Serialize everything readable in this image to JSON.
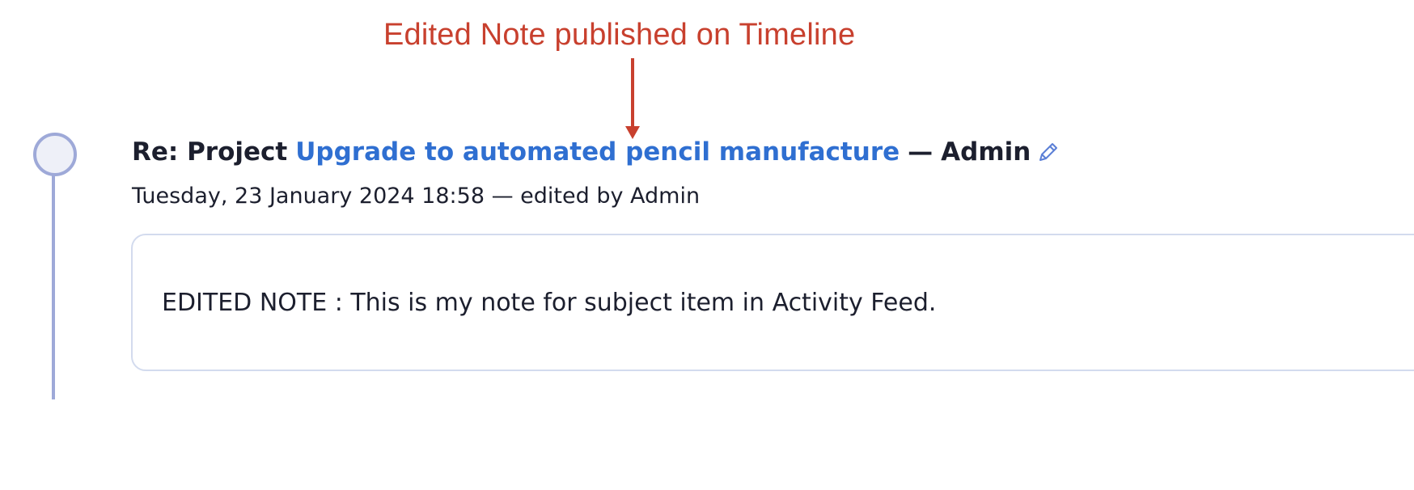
{
  "annotation": {
    "text": "Edited Note published on Timeline",
    "color": "#c8402e"
  },
  "timeline": {
    "line_color": "#9ea9d8"
  },
  "entry": {
    "prefix": "Re: Project",
    "project_link": "Upgrade to automated pencil manufacture",
    "separator": "—",
    "author": "Admin",
    "edit_icon": "pencil-icon",
    "meta": "Tuesday, 23 January 2024 18:58 — edited by Admin",
    "note": "EDITED NOTE : This is my note for subject item in Activity Feed.",
    "link_color": "#2f6fd1"
  }
}
